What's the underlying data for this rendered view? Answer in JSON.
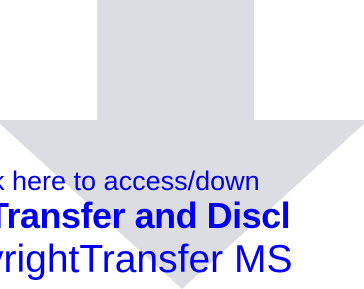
{
  "banner": {
    "download_link_text": "k here to access/down",
    "document_title": "Transfer and Discl",
    "file_name": "yrightTransfer MS",
    "colors": {
      "arrow": "#dcdde3",
      "link": "#0000ee",
      "title": "#0000ee",
      "file_name": "#0000ee"
    },
    "icon": "download-arrow-icon"
  }
}
